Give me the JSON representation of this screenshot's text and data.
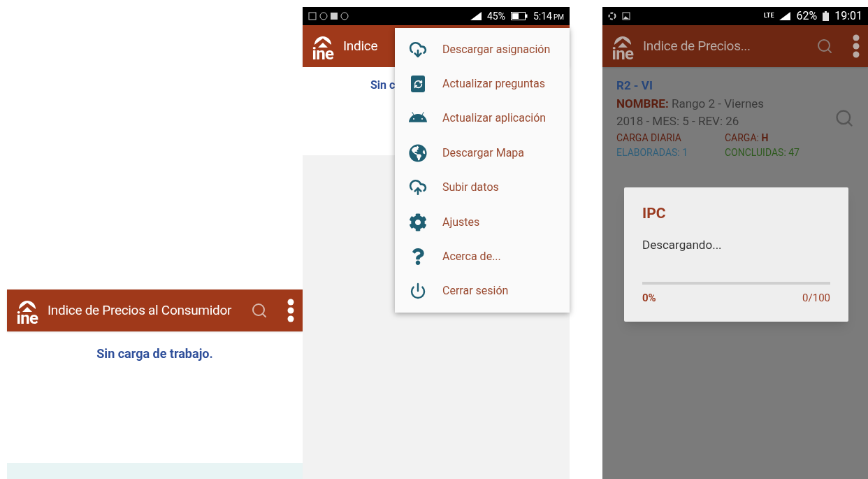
{
  "screens": [
    {
      "kind": "empty",
      "app_bar": {
        "logo_text": "ine",
        "title": "Indice de Precios al Consumidor"
      },
      "message": "Sin carga de trabajo."
    },
    {
      "kind": "menu",
      "status_bar": {
        "battery": "45%",
        "time": "5:14",
        "time_suffix": "PM"
      },
      "app_bar": {
        "logo_text": "ine",
        "title": "Indice"
      },
      "message": "Sin c",
      "menu": {
        "items": [
          {
            "kind": "download",
            "label": "Descargar asignación"
          },
          {
            "kind": "questions",
            "label": "Actualizar preguntas"
          },
          {
            "kind": "app",
            "label": "Actualizar aplicación"
          },
          {
            "kind": "map",
            "label": "Descargar Mapa"
          },
          {
            "kind": "upload",
            "label": "Subir datos"
          },
          {
            "kind": "settings",
            "label": "Ajustes"
          },
          {
            "kind": "about",
            "label": "Acerca de..."
          },
          {
            "kind": "logout",
            "label": "Cerrar sesión"
          }
        ]
      }
    },
    {
      "kind": "dialog",
      "status_bar": {
        "network": "LTE",
        "battery": "62%",
        "time": "19:01"
      },
      "app_bar": {
        "logo_text": "ine",
        "title": "Indice de Precios..."
      },
      "card": {
        "code": "R2 - VI",
        "name": "**NOMBRE:** Rango 2 - Viernes",
        "period": "2018 - MES: 5 - REV: 26",
        "load_type": "CARGA DIARIA",
        "load": "CARGA: **H**",
        "elaborated": "ELABORADAS: 1",
        "concluded": "CONCLUIDAS: 47"
      },
      "dialog": {
        "title": "IPC",
        "message": "Descargando...",
        "level": 0,
        "percent": "0%",
        "count": "0/100"
      }
    }
  ]
}
